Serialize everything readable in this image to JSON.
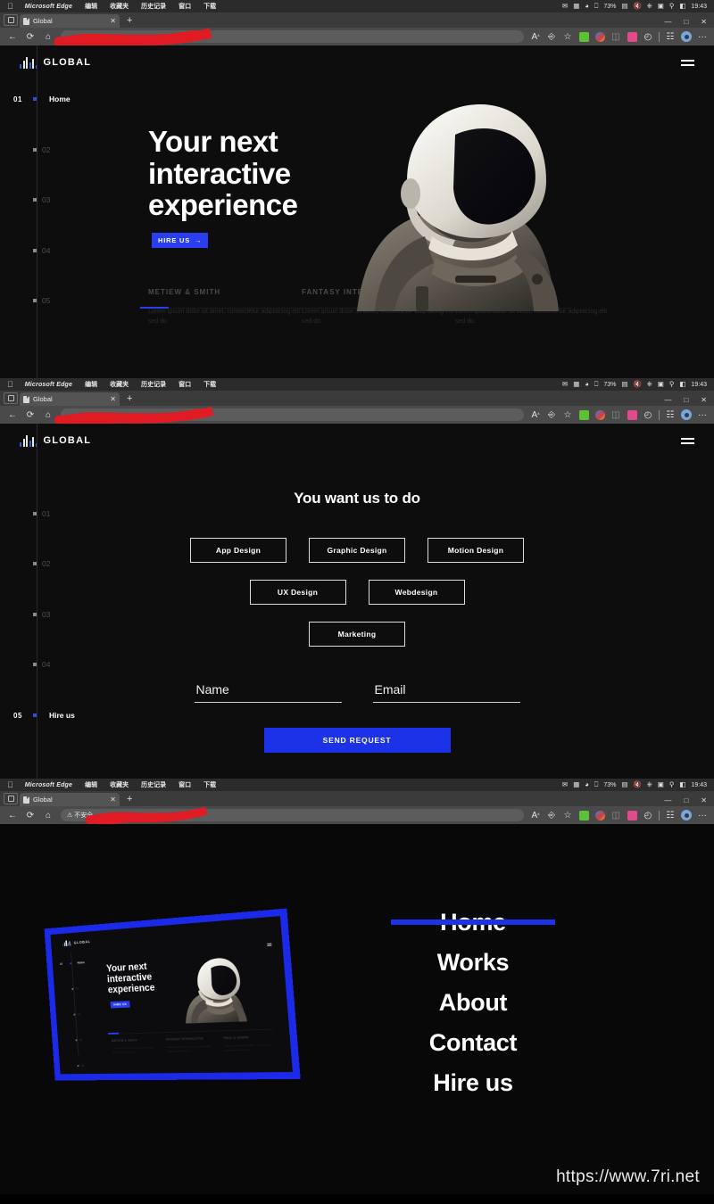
{
  "os": {
    "apple_logo": "apple-logo",
    "menu_items": [
      "Microsoft Edge",
      "编辑",
      "收藏夹",
      "历史记录",
      "窗口",
      "下载"
    ],
    "status": {
      "battery_pct": "73%",
      "time": "19:43",
      "icons": [
        "bluetooth-icon",
        "battery-icon",
        "wifi-icon",
        "display-icon",
        "mute-icon",
        "eject-icon",
        "screenshot-icon",
        "search-icon",
        "control-center-icon"
      ]
    }
  },
  "browser": {
    "tab_overview_icon": "tab-overview-icon",
    "tab": {
      "title": "Global",
      "favicon": "page-icon",
      "close": "✕"
    },
    "newtab_label": "+",
    "window_controls": [
      "minimize-icon",
      "maximize-icon",
      "close-icon"
    ],
    "nav": {
      "back": "←",
      "refresh": "⟳",
      "home": "⌂"
    },
    "omnibox": {
      "placeholder": "",
      "value": "",
      "insecure_warning": "不安全",
      "warning_icon": "warning-triangle-icon"
    },
    "toolbar_right_icons": [
      "read-aloud-icon",
      "translate-icon",
      "favorite-star-icon",
      "extensions-icon",
      "browser-essentials-icon",
      "split-screen-icon",
      "downloads-icon",
      "history-icon",
      "collections-icon",
      "profile-avatar-icon",
      "more-settings-icon"
    ],
    "read_aloud_label": "A",
    "more_label": "···"
  },
  "site": {
    "brand": "GLOBAL",
    "brand_icon": "audio-wave-icon",
    "menu_icon": "hamburger-menu-icon",
    "hero": {
      "title_lines": [
        "Your next",
        "interactive",
        "experience"
      ],
      "cta_label": "HIRE US",
      "cta_arrow": "→",
      "astronaut_image": "astronaut-photo"
    },
    "sidenav": [
      {
        "num": "01",
        "label": "Home",
        "active": true
      },
      {
        "num": "02",
        "label": "",
        "active": false
      },
      {
        "num": "03",
        "label": "",
        "active": false
      },
      {
        "num": "04",
        "label": "",
        "active": false
      },
      {
        "num": "05",
        "label": "",
        "active": false
      }
    ],
    "sidenav_contact": [
      {
        "num": "01",
        "label": "",
        "active": false
      },
      {
        "num": "02",
        "label": "",
        "active": false
      },
      {
        "num": "03",
        "label": "",
        "active": false
      },
      {
        "num": "04",
        "label": "",
        "active": false
      },
      {
        "num": "05",
        "label": "Hire us",
        "active": true
      }
    ],
    "cards": [
      {
        "title": "METIEW & SMITH",
        "text": "Lorem ipsum dolor sit amet, consectetur adipisicing elit sed do"
      },
      {
        "title": "FANTASY INTERACTIVE",
        "text": "Lorem ipsum dolor sit amet, consectetur adipisicing elit sed do."
      },
      {
        "title": "PAUL & SHARK",
        "text": "Lorem ipsum dolor sit amet, consectetur adipisicing elit sed do."
      }
    ],
    "contact": {
      "title": "You want us to do",
      "services_row1": [
        "App Design",
        "Graphic Design",
        "Motion Design"
      ],
      "services_row2": [
        "UX Design",
        "Webdesign"
      ],
      "services_row3": [
        "Marketing"
      ],
      "name_placeholder": "Name",
      "name_value": "",
      "email_placeholder": "Email",
      "email_value": "",
      "submit_label": "SEND REQUEST"
    },
    "overlay_menu": [
      {
        "label": "Home",
        "active": true
      },
      {
        "label": "Works",
        "active": false
      },
      {
        "label": "About",
        "active": false
      },
      {
        "label": "Contact",
        "active": false
      },
      {
        "label": "Hire us",
        "active": false
      }
    ]
  },
  "watermark": "https://www.7ri.net",
  "colors": {
    "accent_blue": "#1c32e8",
    "hero_blue": "#2a3ef0",
    "site_bg": "#0d0d0d",
    "chrome_toolbar": "#4a4a4a",
    "redaction": "#e01b24"
  }
}
